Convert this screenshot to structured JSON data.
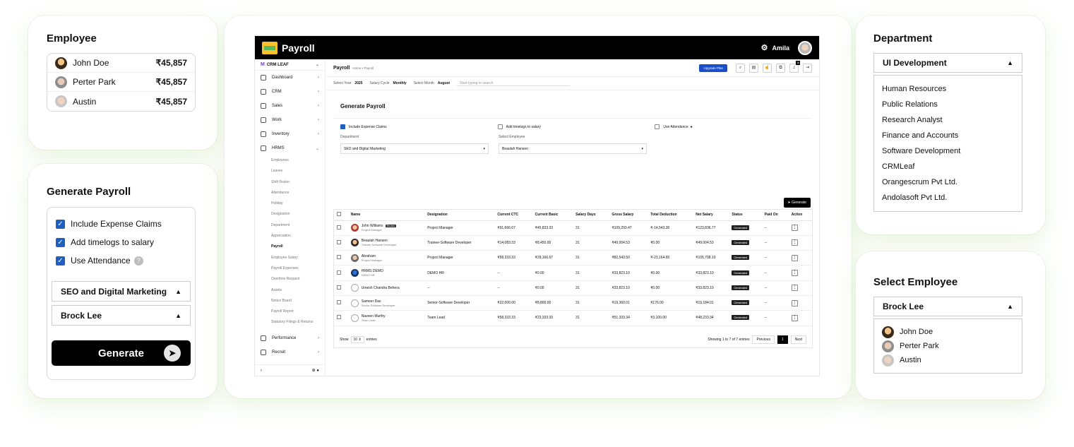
{
  "employee_card": {
    "title": "Employee",
    "rows": [
      {
        "name": "John Doe",
        "amount": "₹45,857"
      },
      {
        "name": "Perter Park",
        "amount": "₹45,857"
      },
      {
        "name": "Austin",
        "amount": "₹45,857"
      }
    ]
  },
  "generate_card": {
    "title": "Generate Payroll",
    "checks": [
      "Include Expense Claims",
      "Add timelogs to salary",
      "Use Attendance"
    ],
    "department": "SEO and Digital Marketing",
    "employee": "Brock Lee",
    "button": "Generate"
  },
  "department_card": {
    "title": "Department",
    "selected": "UI Development",
    "options": [
      "Human Resources",
      "Public Relations",
      "Research Analyst",
      "Finance and Accounts",
      "Software Development",
      "CRMLeaf",
      "Orangescrum Pvt Ltd.",
      "Andolasoft Pvt Ltd."
    ]
  },
  "select_employee_card": {
    "title": "Select Employee",
    "selected": "Brock Lee",
    "options": [
      "John Doe",
      "Perter Park",
      "Austin"
    ]
  },
  "app": {
    "brand": "Payroll",
    "user": "Amila",
    "org": "CRM LEAF",
    "sidebar": {
      "items": [
        "Dashboard",
        "CRM",
        "Sales",
        "Work",
        "Inventory",
        "HRMS"
      ],
      "sub": [
        "Employees",
        "Leaves",
        "Shift Roster",
        "Attendance",
        "Holiday",
        "Designation",
        "Department",
        "Appreciation",
        "Payroll",
        "Employee Salary",
        "Payroll Expenses",
        "Overtime Request",
        "Assets",
        "Notice Board",
        "Payroll Report",
        "Statutory Filings & Returns"
      ],
      "bottom": [
        "Performance",
        "Recruit"
      ]
    },
    "page_title": "Payroll",
    "breadcrumb": "Home • Payroll",
    "upgrade": "Upgrade Plan",
    "badge": "16",
    "filters": {
      "year_label": "Select Year",
      "year": "2025",
      "cycle_label": "Salary Cycle",
      "cycle": "Monthly",
      "month_label": "Select Month",
      "month": "August",
      "search_placeholder": "Start typing to search"
    },
    "panel": {
      "title": "Generate Payroll",
      "opt1": "Include Expense Claims",
      "opt2": "Add timelogs to salary",
      "opt3": "Use Attendance",
      "dept_label": "Department",
      "emp_label": "Select Employee",
      "dept_value": "SEO and Digital Marketing",
      "emp_value": "Beaulah Hansen",
      "generate": "Generate"
    },
    "table": {
      "headers": [
        "Name",
        "Designation",
        "Current CTC",
        "Current Basic",
        "Salary Days",
        "Gross Salary",
        "Total Deduction",
        "Net Salary",
        "Status",
        "Paid On",
        "Action"
      ],
      "its_you": "It's you",
      "rows": [
        {
          "name": "John Williams",
          "role": "Project Manager",
          "designation": "Project Manager",
          "ctc": "₹91,666.67",
          "basic": "₹45,833.33",
          "days": "31",
          "gross": "₹109,293.47",
          "deduction": "₹-14,543.30",
          "net": "₹123,836.77",
          "status": "Generated",
          "paid": "--"
        },
        {
          "name": "Beaulah Hansen",
          "role": "Trainee-Software Developer",
          "designation": "Trainee-Software Developer",
          "ctc": "₹14,083.33",
          "basic": "₹8,450.00",
          "days": "31",
          "gross": "₹49,004.53",
          "deduction": "₹0.00",
          "net": "₹49,004.53",
          "status": "Generated",
          "paid": "--"
        },
        {
          "name": "Abraham",
          "role": "Project Manager",
          "designation": "Project Manager",
          "ctc": "₹58,333.33",
          "basic": "₹29,166.67",
          "days": "31",
          "gross": "₹82,543.50",
          "deduction": "₹-23,164.60",
          "net": "₹105,708.10",
          "status": "Generated",
          "paid": "--"
        },
        {
          "name": "HRMS DEMO",
          "role": "DEMO HR",
          "designation": "DEMO HR",
          "ctc": "--",
          "basic": "₹0.00",
          "days": "31",
          "gross": "₹33,823.10",
          "deduction": "₹0.00",
          "net": "₹33,823.10",
          "status": "Generated",
          "paid": "--"
        },
        {
          "name": "Umesh Chandra Behera",
          "role": "",
          "designation": "--",
          "ctc": "--",
          "basic": "₹0.00",
          "days": "31",
          "gross": "₹33,823.10",
          "deduction": "₹0.00",
          "net": "₹33,823.10",
          "status": "Generated",
          "paid": "--"
        },
        {
          "name": "Sameer Das",
          "role": "Senior-Software Developer",
          "designation": "Senior-Software Developer",
          "ctc": "₹22,000.00",
          "basic": "₹8,800.00",
          "days": "31",
          "gross": "₹19,360.01",
          "deduction": "₹176.00",
          "net": "₹19,184.01",
          "status": "Generated",
          "paid": "--"
        },
        {
          "name": "Naveen Murthy",
          "role": "Team Lead",
          "designation": "Team Lead",
          "ctc": "₹58,333.33",
          "basic": "₹23,333.33",
          "days": "31",
          "gross": "₹51,333.34",
          "deduction": "₹3,100.00",
          "net": "₹48,233.34",
          "status": "Generated",
          "paid": "--"
        }
      ],
      "show": "Show",
      "entries_val": "10",
      "entries": "entries",
      "info": "Showing 1 to 7 of 7 entries",
      "prev": "Previous",
      "page": "1",
      "next": "Next"
    }
  }
}
